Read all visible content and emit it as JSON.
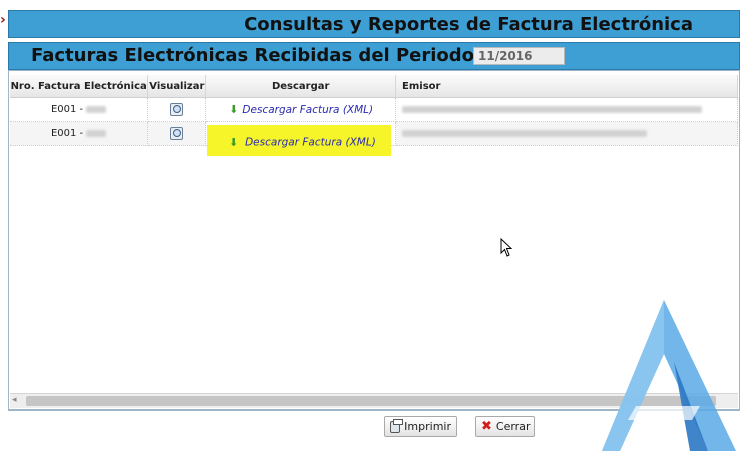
{
  "header": {
    "title": "Consultas y Reportes de Factura Electrónica",
    "subtitle": "Facturas Electrónicas Recibidas del Periodo",
    "period": "11/2016"
  },
  "table": {
    "columns": [
      "Nro. Factura Electrónica",
      "Visualizar",
      "Descargar",
      "Emisor"
    ],
    "rows": [
      {
        "nro": "E001 -",
        "download": "Descargar Factura (XML)"
      },
      {
        "nro": "E001 -",
        "download": "Descargar Factura (XML)"
      }
    ]
  },
  "footer": {
    "print_label": "Imprimir",
    "close_label": "Cerrar"
  },
  "icons": {
    "chevron": "chevron-right-icon",
    "view": "magnifier-document-icon",
    "download": "download-arrow-icon",
    "print": "printer-icon",
    "close": "red-x-icon"
  },
  "colors": {
    "header_bg": "#3d9fd3",
    "highlight": "#f5f52a",
    "link": "#2a2ab0"
  }
}
